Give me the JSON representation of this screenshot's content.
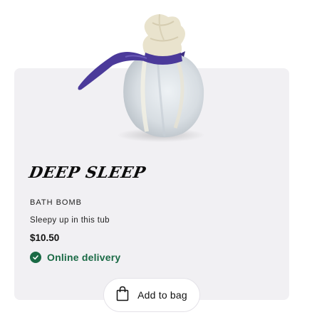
{
  "product": {
    "name": "DEEP SLEEP",
    "category": "BATH BOMB",
    "description": "Sleepy up in this tub",
    "price": "$10.50",
    "delivery_label": "Online delivery",
    "image_icon": "bath-bomb-wrapped-in-cloth"
  },
  "actions": {
    "add_to_bag_label": "Add to bag",
    "bag_icon": "shopping-bag-icon"
  },
  "colors": {
    "card_background": "#f1f0f3",
    "delivery_green": "#1a6a45",
    "ribbon_purple": "#4b3a9a"
  }
}
